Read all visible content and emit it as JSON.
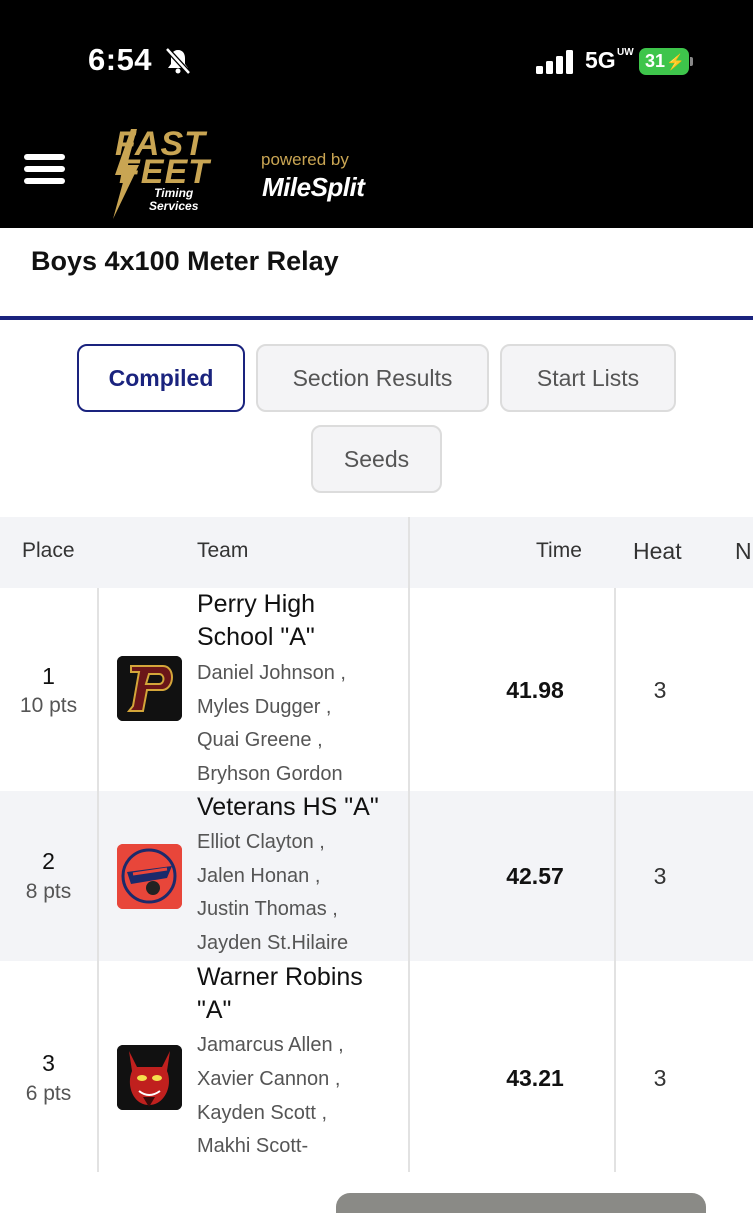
{
  "status_bar": {
    "time": "6:54",
    "network": "5G",
    "network_sup": "UW",
    "battery": "31"
  },
  "header": {
    "logo_line1": "FAST",
    "logo_line2": "FEET",
    "logo_line3": "Timing",
    "logo_line4": "Services",
    "powered_by": "powered by",
    "brand": "MileSplit"
  },
  "page": {
    "title": "Boys 4x100 Meter Relay"
  },
  "tabs": [
    {
      "label": "Compiled",
      "active": true
    },
    {
      "label": "Section Results",
      "active": false
    },
    {
      "label": "Start Lists",
      "active": false
    },
    {
      "label": "Seeds",
      "active": false
    }
  ],
  "table": {
    "headers": {
      "place": "Place",
      "team": "Team",
      "time": "Time",
      "heat": "Heat",
      "next": "N"
    },
    "rows": [
      {
        "place": "1",
        "points": "10 pts",
        "team_line1": "Perry High",
        "team_line2": "School \"A\"",
        "athletes": [
          "Daniel Johnson ,",
          "Myles Dugger ,",
          "Quai Greene ,",
          "Bryhson Gordon"
        ],
        "time": "41.98",
        "heat": "3"
      },
      {
        "place": "2",
        "points": "8 pts",
        "team_line1": "Veterans HS \"A\"",
        "team_line2": "",
        "athletes": [
          "Elliot Clayton ,",
          "Jalen Honan ,",
          "Justin Thomas ,",
          "Jayden St.Hilaire"
        ],
        "time": "42.57",
        "heat": "3"
      },
      {
        "place": "3",
        "points": "6 pts",
        "team_line1": "Warner Robins",
        "team_line2": "\"A\"",
        "athletes": [
          "Jamarcus Allen ,",
          "Xavier Cannon ,",
          "Kayden Scott ,",
          "Makhi Scott-"
        ],
        "time": "43.21",
        "heat": "3"
      }
    ]
  }
}
